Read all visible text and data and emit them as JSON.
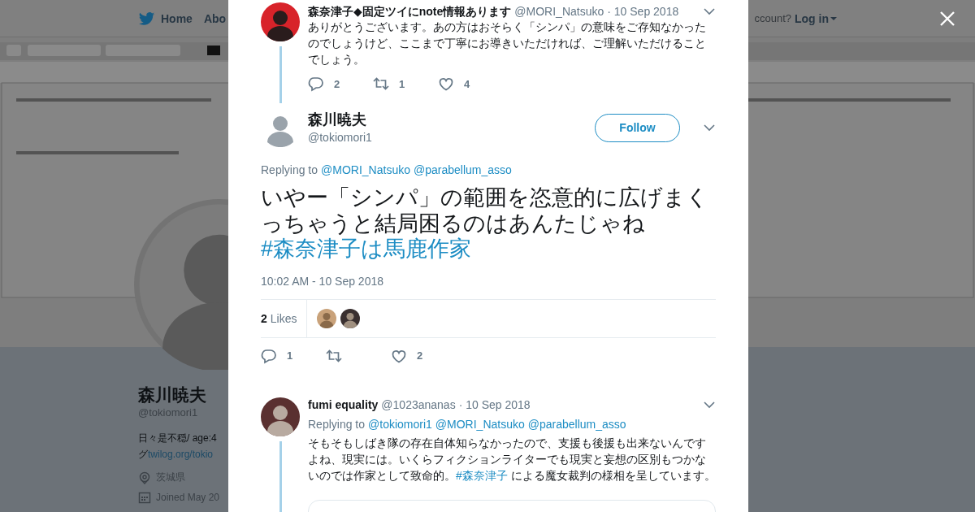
{
  "background_page": {
    "nav": {
      "links": [
        {
          "label": "Home",
          "kind": "home"
        },
        {
          "label": "Abo",
          "kind": "plain"
        }
      ],
      "account_prompt": "ccount?",
      "login": "Log in"
    },
    "profile": {
      "name": "森川暁夫",
      "handle": "@tokiomori1",
      "bio_line": "日々是不穏/ age:4",
      "bio_prefix": "グ",
      "bio_link": "twilog.org/tokio",
      "location": "茨城県",
      "joined": "Joined May 20"
    }
  },
  "parent_tweet": {
    "name": "森奈津子◆固定ツイにnote情報あります",
    "handle": "@MORI_Natsuko",
    "date": "· 10 Sep 2018",
    "text": "ありがとうございます。あの方はおそらく「シンパ」の意味をご存知なかったのでしょうけど、ここまで丁寧にお導きいただければ、ご理解いただけることでしょう。",
    "actions": [
      {
        "kind": "reply",
        "count": "2"
      },
      {
        "kind": "retweet",
        "count": "1"
      },
      {
        "kind": "like",
        "count": "4"
      }
    ]
  },
  "main_tweet": {
    "name": "森川暁夫",
    "handle": "@tokiomori1",
    "follow": "Follow",
    "replying_label": "Replying to",
    "mentions": [
      "@MORI_Natsuko",
      "@parabellum_asso"
    ],
    "text": [
      {
        "kind": "text",
        "text": "いやー「シンパ」の範囲を恣意的に広げまくっちゃうと結局困るのはあんたじゃね "
      },
      {
        "kind": "hashtag",
        "text": "#森奈津子は馬鹿作家"
      }
    ],
    "timestamp": "10:02 AM - 10 Sep 2018",
    "likes": {
      "count": "2",
      "label": "Likes"
    },
    "actions": [
      {
        "kind": "reply",
        "count": "1"
      },
      {
        "kind": "retweet"
      },
      {
        "kind": "like",
        "count": "2"
      }
    ]
  },
  "reply_tweet": {
    "name": "fumi equality",
    "handle": "@1023ananas",
    "date": "· 10 Sep 2018",
    "replying_label": "Replying to",
    "mentions": [
      "@tokiomori1",
      "@MORI_Natsuko",
      "@parabellum_asso"
    ],
    "text": [
      {
        "kind": "text",
        "text": "そもそもしばき隊の存在自体知らなかったので、支援も後援も出来ないんですよね、現実には。いくらフィクションライターでも現実と妄想の区別もつかないのでは作家として致命的。"
      },
      {
        "kind": "hashtag",
        "text": "#森奈津子"
      },
      {
        "kind": "text",
        "text": " による魔女裁判の様相を呈しています。"
      }
    ]
  }
}
